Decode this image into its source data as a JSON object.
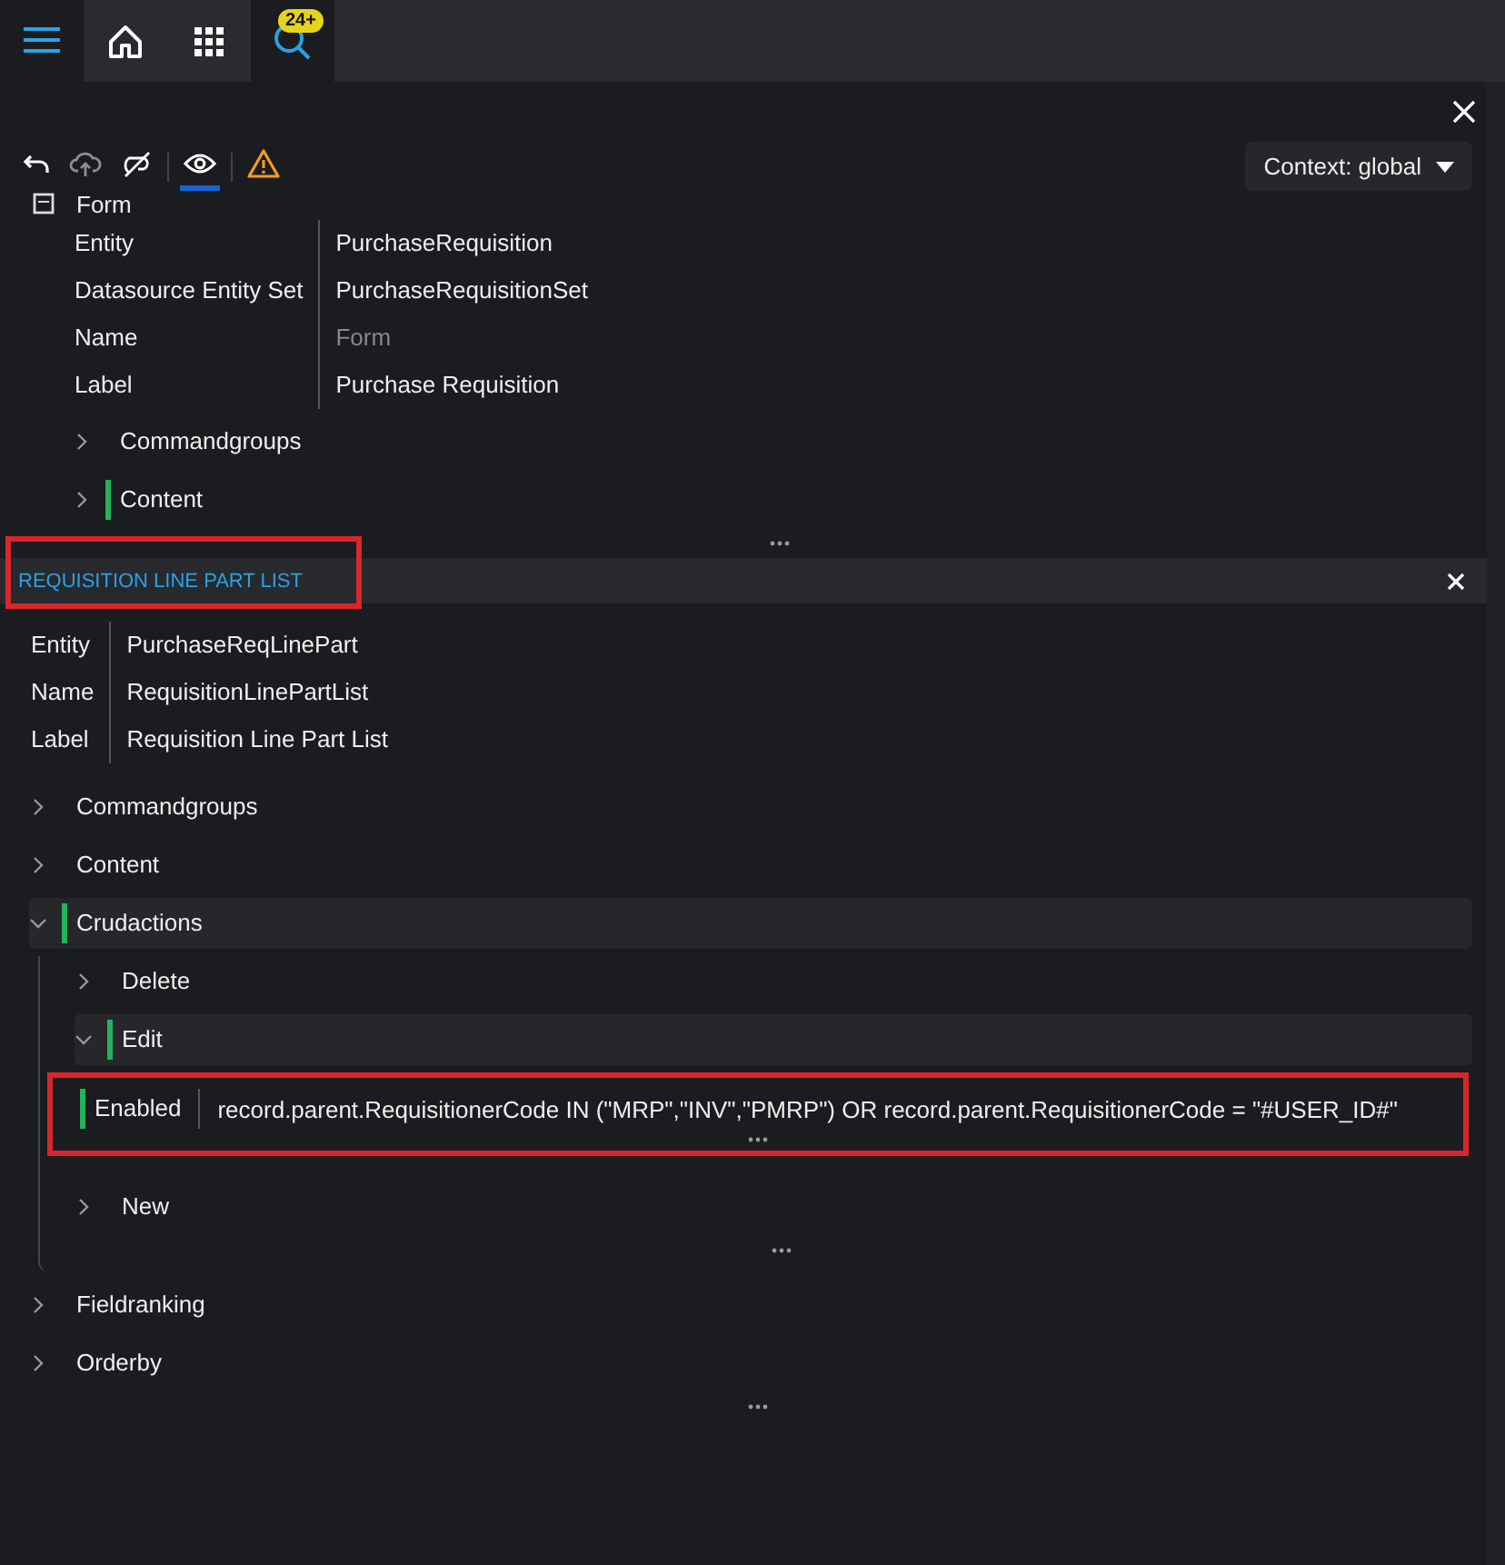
{
  "topbar": {
    "tabs": [
      {
        "kind": "home",
        "selected": false
      },
      {
        "kind": "apps",
        "selected": false
      },
      {
        "kind": "search",
        "selected": true,
        "badge": "24+"
      }
    ]
  },
  "toolbar": {
    "buttons": [
      {
        "kind": "undo",
        "disabled": false,
        "selected": false
      },
      {
        "kind": "upload",
        "disabled": true,
        "selected": false
      },
      {
        "kind": "hide",
        "disabled": false,
        "selected": false
      },
      {
        "kind": "show",
        "disabled": false,
        "selected": true
      },
      {
        "kind": "warning",
        "disabled": false,
        "selected": false
      }
    ],
    "context": "Context: global"
  },
  "form": {
    "title": "Form",
    "properties": [
      {
        "label": "Entity",
        "value": "PurchaseRequisition",
        "dimmed": false
      },
      {
        "label": "Datasource Entity Set",
        "value": "PurchaseRequisitionSet",
        "dimmed": false
      },
      {
        "label": "Name",
        "value": "Form",
        "dimmed": true
      },
      {
        "label": "Label",
        "value": "Purchase Requisition",
        "dimmed": false
      }
    ],
    "nodes": [
      {
        "kind": "node",
        "label": "Commandgroups",
        "expanded": false,
        "changed": false
      },
      {
        "kind": "node",
        "label": "Content",
        "expanded": false,
        "changed": true
      }
    ]
  },
  "section": {
    "title": "REQUISITION LINE PART LIST",
    "highlighted": true,
    "properties": [
      {
        "label": "Entity",
        "value": "PurchaseReqLinePart",
        "dimmed": false
      },
      {
        "label": "Name",
        "value": "RequisitionLinePartList",
        "dimmed": false
      },
      {
        "label": "Label",
        "value": "Requisition Line Part List",
        "dimmed": false
      }
    ],
    "nodes": [
      {
        "kind": "node",
        "label": "Commandgroups",
        "expanded": false,
        "changed": false
      },
      {
        "kind": "node",
        "label": "Content",
        "expanded": false,
        "changed": false
      },
      {
        "kind": "node",
        "label": "Crudactions",
        "expanded": true,
        "changed": true,
        "children": [
          {
            "kind": "node",
            "label": "Delete",
            "expanded": false,
            "changed": false
          },
          {
            "kind": "node",
            "label": "Edit",
            "expanded": true,
            "changed": true,
            "children": [
              {
                "kind": "property",
                "label": "Enabled",
                "value": "record.parent.RequisitionerCode IN (\"MRP\",\"INV\",\"PMRP\") OR record.parent.RequisitionerCode = \"#USER_ID#\"",
                "changed": true,
                "highlighted": true
              }
            ]
          },
          {
            "kind": "node",
            "label": "New",
            "expanded": false,
            "changed": false
          }
        ]
      },
      {
        "kind": "node",
        "label": "Fieldranking",
        "expanded": false,
        "changed": false
      },
      {
        "kind": "node",
        "label": "Orderby",
        "expanded": false,
        "changed": false
      }
    ]
  }
}
